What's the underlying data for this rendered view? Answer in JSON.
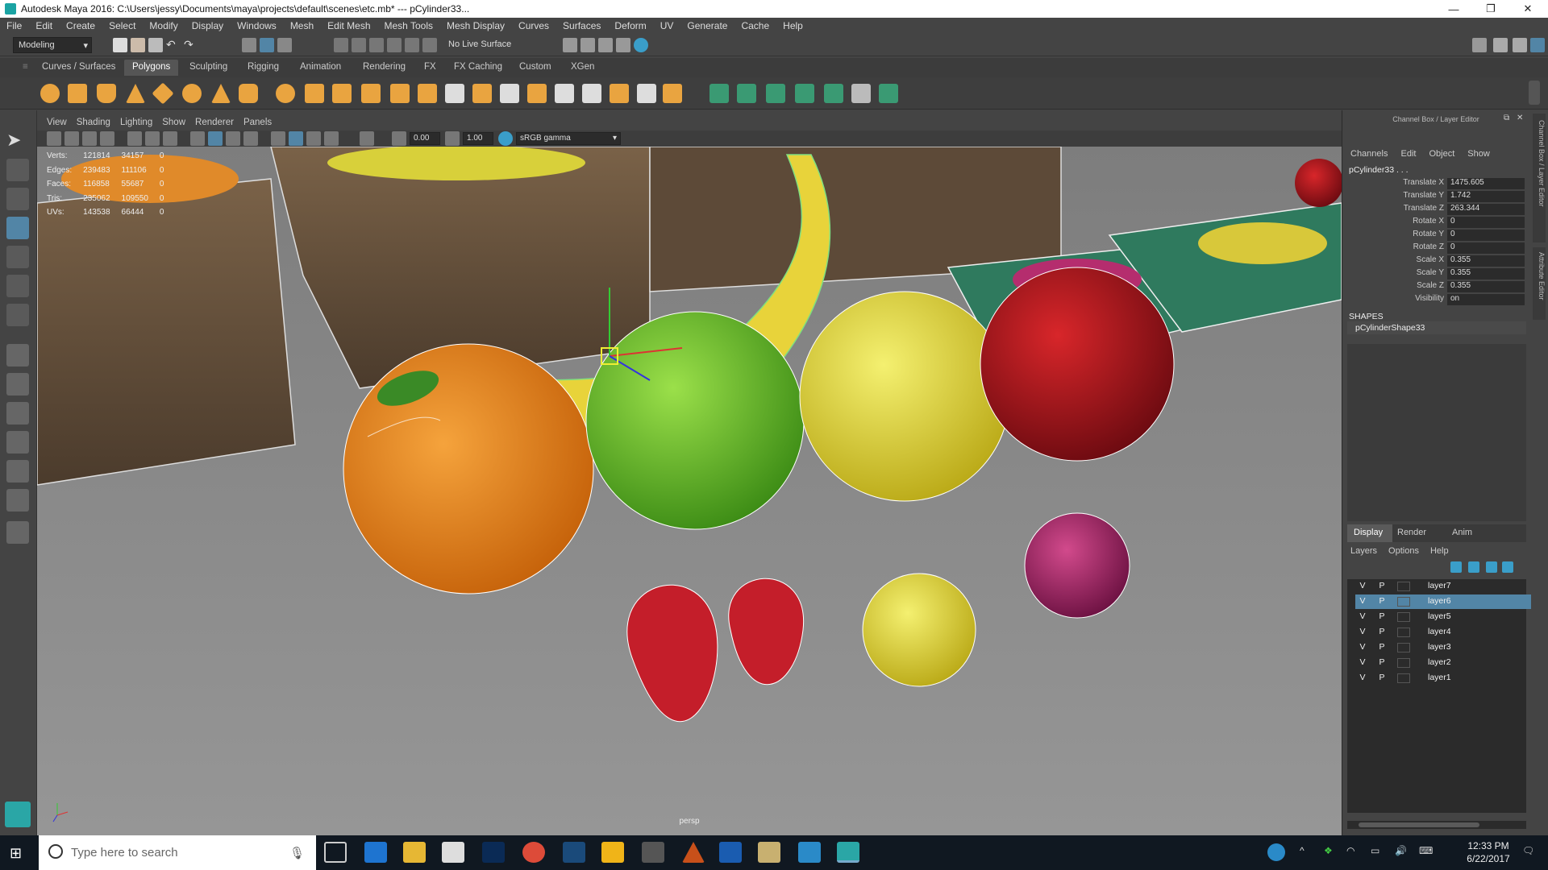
{
  "window": {
    "title": "Autodesk Maya 2016: C:\\Users\\jessy\\Documents\\maya\\projects\\default\\scenes\\etc.mb*   ---   pCylinder33...",
    "min": "—",
    "max": "❐",
    "close": "✕"
  },
  "menus": [
    "File",
    "Edit",
    "Create",
    "Select",
    "Modify",
    "Display",
    "Windows",
    "Mesh",
    "Edit Mesh",
    "Mesh Tools",
    "Mesh Display",
    "Curves",
    "Surfaces",
    "Deform",
    "UV",
    "Generate",
    "Cache",
    "Help"
  ],
  "status": {
    "mode": "Modeling",
    "live_surface": "No Live Surface"
  },
  "shelf_tabs": [
    "Curves / Surfaces",
    "Polygons",
    "Sculpting",
    "Rigging",
    "Animation",
    "Rendering",
    "FX",
    "FX Caching",
    "Custom",
    "XGen"
  ],
  "active_shelf": "Polygons",
  "viewport": {
    "menus": [
      "View",
      "Shading",
      "Lighting",
      "Show",
      "Renderer",
      "Panels"
    ],
    "exposure": "0.00",
    "gamma": "1.00",
    "colorspace": "sRGB gamma",
    "camera": "persp",
    "hud": [
      {
        "label": "Verts:",
        "a": "121814",
        "b": "34157",
        "c": "0"
      },
      {
        "label": "Edges:",
        "a": "239483",
        "b": "111106",
        "c": "0"
      },
      {
        "label": "Faces:",
        "a": "116858",
        "b": "55687",
        "c": "0"
      },
      {
        "label": "Tris:",
        "a": "235062",
        "b": "109550",
        "c": "0"
      },
      {
        "label": "UVs:",
        "a": "143538",
        "b": "66444",
        "c": "0"
      }
    ]
  },
  "channel_box": {
    "header": "Channel Box / Layer Editor",
    "menus": [
      "Channels",
      "Edit",
      "Object",
      "Show"
    ],
    "object": "pCylinder33 . . .",
    "channels": [
      {
        "label": "Translate X",
        "value": "1475.605"
      },
      {
        "label": "Translate Y",
        "value": "1.742"
      },
      {
        "label": "Translate Z",
        "value": "263.344"
      },
      {
        "label": "Rotate X",
        "value": "0"
      },
      {
        "label": "Rotate Y",
        "value": "0"
      },
      {
        "label": "Rotate Z",
        "value": "0"
      },
      {
        "label": "Scale X",
        "value": "0.355"
      },
      {
        "label": "Scale Y",
        "value": "0.355"
      },
      {
        "label": "Scale Z",
        "value": "0.355"
      },
      {
        "label": "Visibility",
        "value": "on"
      }
    ],
    "shapes_label": "SHAPES",
    "shape": "pCylinderShape33",
    "side_tabs": [
      "Channel Box / Layer Editor",
      "Attribute Editor"
    ]
  },
  "layer_editor": {
    "tabs": [
      "Display",
      "Render",
      "Anim"
    ],
    "menus": [
      "Layers",
      "Options",
      "Help"
    ],
    "layers": [
      {
        "v": "V",
        "p": "P",
        "name": "layer7"
      },
      {
        "v": "V",
        "p": "P",
        "name": "layer6"
      },
      {
        "v": "V",
        "p": "P",
        "name": "layer5"
      },
      {
        "v": "V",
        "p": "P",
        "name": "layer4"
      },
      {
        "v": "V",
        "p": "P",
        "name": "layer3"
      },
      {
        "v": "V",
        "p": "P",
        "name": "layer2"
      },
      {
        "v": "V",
        "p": "P",
        "name": "layer1"
      }
    ],
    "selected": "layer6"
  },
  "taskbar": {
    "search_placeholder": "Type here to search",
    "time": "12:33 PM",
    "date": "6/22/2017"
  },
  "colors": {
    "accent": "#5285a6",
    "viewport_bg": "#8a8a8a",
    "ui_bg": "#444444",
    "taskbar": "#101821"
  }
}
